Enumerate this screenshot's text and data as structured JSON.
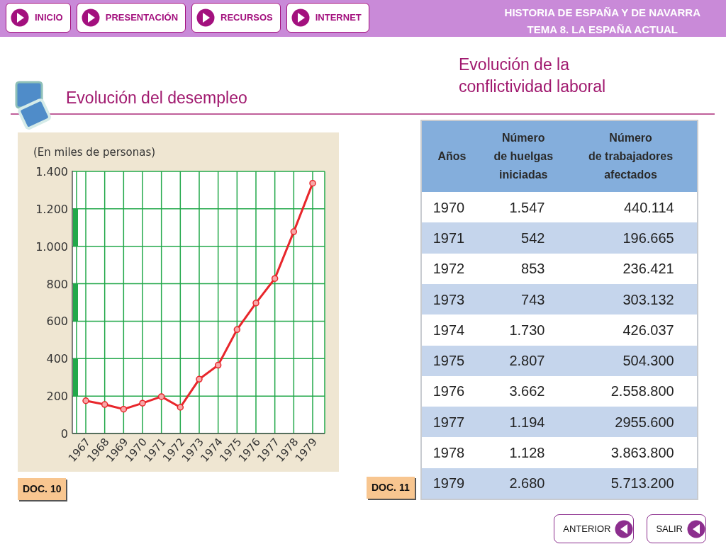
{
  "header": {
    "nav_buttons": [
      {
        "label": "INICIO"
      },
      {
        "label": "PRESENTACIÓN"
      },
      {
        "label": "RECURSOS"
      },
      {
        "label": "INTERNET"
      }
    ],
    "title_lines": [
      "HISTORIA DE ESPAÑA Y DE NAVARRA",
      "TEMA 8. LA ESPAÑA ACTUAL"
    ]
  },
  "unemployment": {
    "title": "Evolución del desempleo",
    "chart_data": {
      "type": "line",
      "ylabel": "(En miles de personas)",
      "categories": [
        "1967",
        "1968",
        "1969",
        "1970",
        "1971",
        "1972",
        "1973",
        "1974",
        "1975",
        "1976",
        "1977",
        "1978",
        "1979"
      ],
      "grid": true,
      "series": [
        {
          "color": "#e8262b",
          "marker": "o",
          "values": [
            175,
            155,
            130,
            162,
            197,
            140,
            290,
            365,
            555,
            697,
            828,
            1078,
            1337
          ]
        }
      ],
      "ylim": [
        0,
        1400
      ],
      "yticks": [
        {
          "value": 0,
          "label": "0"
        },
        {
          "value": 200,
          "label": "200"
        },
        {
          "value": 400,
          "label": "400"
        },
        {
          "value": 600,
          "label": "600"
        },
        {
          "value": 800,
          "label": "800"
        },
        {
          "value": 1000,
          "label": "1.000"
        },
        {
          "value": 1200,
          "label": "1.200"
        },
        {
          "value": 1400,
          "label": "1.400"
        }
      ]
    },
    "doc_label": "DOC. 10"
  },
  "strikes": {
    "title_lines": [
      "Evolución de la",
      "conflictividad laboral"
    ],
    "table": {
      "columns": [
        "Años",
        "Número\nde huelgas\niniciadas",
        "Número\nde trabajadores\nafectados"
      ],
      "rows": [
        [
          "1970",
          "1.547",
          "440.114"
        ],
        [
          "1971",
          "542",
          "196.665"
        ],
        [
          "1972",
          "853",
          "236.421"
        ],
        [
          "1973",
          "743",
          "303.132"
        ],
        [
          "1974",
          "1.730",
          "426.037"
        ],
        [
          "1975",
          "2.807",
          "504.300"
        ],
        [
          "1976",
          "3.662",
          "2.558.800"
        ],
        [
          "1977",
          "1.194",
          "2955.600"
        ],
        [
          "1978",
          "1.128",
          "3.863.800"
        ],
        [
          "1979",
          "2.680",
          "5.713.200"
        ]
      ]
    },
    "doc_label": "DOC. 11"
  },
  "footer_buttons": [
    {
      "label": "ANTERIOR"
    },
    {
      "label": "SALIR"
    }
  ]
}
